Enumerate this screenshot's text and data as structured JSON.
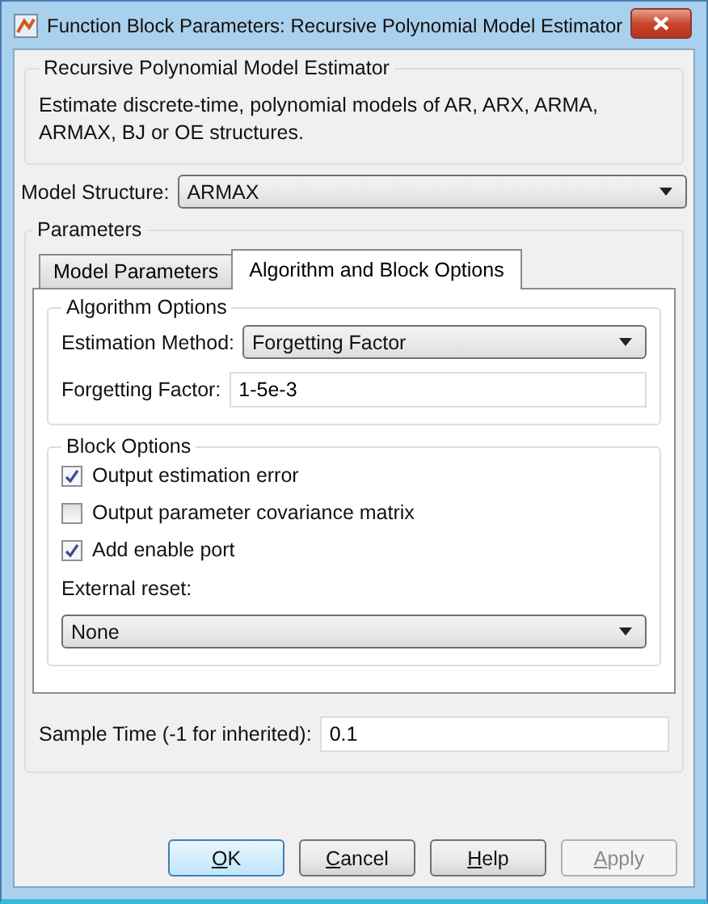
{
  "window": {
    "title": "Function Block Parameters: Recursive Polynomial Model Estimator"
  },
  "description": {
    "title": "Recursive Polynomial Model Estimator",
    "text": "Estimate discrete-time, polynomial models of AR, ARX, ARMA, ARMAX, BJ or OE structures."
  },
  "model_structure": {
    "label": "Model Structure:",
    "value": "ARMAX"
  },
  "parameters": {
    "title": "Parameters",
    "tabs": [
      {
        "label": "Model Parameters",
        "selected": false
      },
      {
        "label": "Algorithm and Block Options",
        "selected": true
      }
    ],
    "algorithm_options": {
      "title": "Algorithm Options",
      "estimation_method": {
        "label": "Estimation Method:",
        "value": "Forgetting Factor"
      },
      "forgetting_factor": {
        "label": "Forgetting Factor:",
        "value": "1-5e-3"
      }
    },
    "block_options": {
      "title": "Block Options",
      "checkboxes": [
        {
          "label": "Output estimation error",
          "checked": true
        },
        {
          "label": "Output parameter covariance matrix",
          "checked": false
        },
        {
          "label": "Add enable port",
          "checked": true
        }
      ],
      "external_reset": {
        "label": "External reset:",
        "value": "None"
      }
    }
  },
  "sample_time": {
    "label": "Sample Time (-1 for inherited):",
    "value": "0.1"
  },
  "buttons": [
    {
      "key": "O",
      "rest": "K",
      "default": true,
      "disabled": false
    },
    {
      "key": "C",
      "rest": "ancel",
      "default": false,
      "disabled": false
    },
    {
      "key": "H",
      "rest": "elp",
      "default": false,
      "disabled": false
    },
    {
      "key": "A",
      "rest": "pply",
      "default": false,
      "disabled": true
    }
  ]
}
